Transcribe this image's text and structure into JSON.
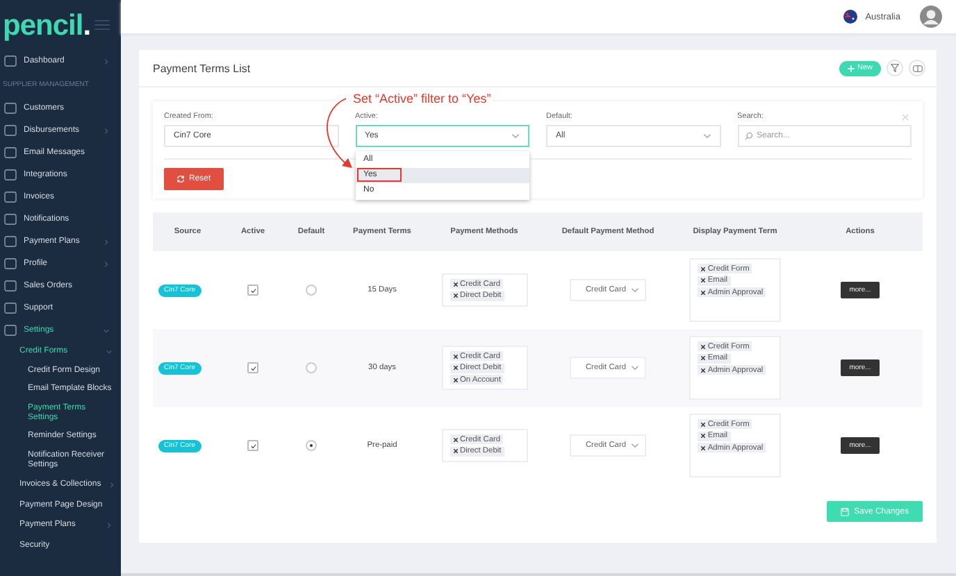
{
  "logo": {
    "text": "pencil",
    "mark": "."
  },
  "header": {
    "country": "Australia"
  },
  "sidebar": {
    "items": [
      {
        "label": "Dashboard",
        "kind": "item",
        "has_submenu": true,
        "selected": false,
        "expanded": false
      },
      {
        "label": "SUPPLIER MANAGEMENT",
        "kind": "section"
      },
      {
        "label": "Customers",
        "kind": "item",
        "has_submenu": false,
        "selected": false
      },
      {
        "label": "Disbursements",
        "kind": "item",
        "has_submenu": true,
        "selected": false,
        "expanded": false
      },
      {
        "label": "Email Messages",
        "kind": "item",
        "has_submenu": false,
        "selected": false
      },
      {
        "label": "Integrations",
        "kind": "item",
        "has_submenu": false,
        "selected": false
      },
      {
        "label": "Invoices",
        "kind": "item",
        "has_submenu": false,
        "selected": false
      },
      {
        "label": "Notifications",
        "kind": "item",
        "has_submenu": false,
        "selected": false
      },
      {
        "label": "Payment Plans",
        "kind": "item",
        "has_submenu": true,
        "selected": false,
        "expanded": false
      },
      {
        "label": "Profile",
        "kind": "item",
        "has_submenu": true,
        "selected": false,
        "expanded": false
      },
      {
        "label": "Sales Orders",
        "kind": "item",
        "has_submenu": false,
        "selected": false
      },
      {
        "label": "Support",
        "kind": "item",
        "has_submenu": false,
        "selected": false
      },
      {
        "label": "Settings",
        "kind": "item",
        "has_submenu": true,
        "selected": true,
        "expanded": true,
        "children": [
          {
            "label": "Credit Forms",
            "has_submenu": true,
            "selected": true,
            "expanded": true,
            "children": [
              {
                "label": "Credit Form Design",
                "selected": false
              },
              {
                "label": "Email Template Blocks",
                "selected": false
              },
              {
                "label": "Payment Terms Settings",
                "selected": true
              },
              {
                "label": "Reminder Settings",
                "selected": false
              },
              {
                "label": "Notification Receiver Settings",
                "selected": false
              }
            ]
          },
          {
            "label": "Invoices & Collections",
            "has_submenu": true,
            "selected": false,
            "expanded": false
          },
          {
            "label": "Payment Page Design",
            "has_submenu": false,
            "selected": false
          },
          {
            "label": "Payment Plans",
            "has_submenu": true,
            "selected": false,
            "expanded": false
          },
          {
            "label": "Security",
            "has_submenu": false,
            "selected": false
          }
        ]
      }
    ]
  },
  "page": {
    "title": "Payment Terms List",
    "new_button": "New"
  },
  "filters": [
    {
      "kind": "text",
      "label": "Created From:",
      "value": "Cin7 Core"
    },
    {
      "kind": "select",
      "label": "Active:",
      "value": "Yes",
      "open": true,
      "options": [
        {
          "label": "All",
          "selected": false,
          "highlighted": false
        },
        {
          "label": "Yes",
          "selected": true,
          "highlighted": true
        },
        {
          "label": "No",
          "selected": false,
          "highlighted": false
        }
      ]
    },
    {
      "kind": "select",
      "label": "Default:",
      "value": "All",
      "open": false
    },
    {
      "kind": "search",
      "label": "Search:",
      "placeholder": "Search..."
    }
  ],
  "reset_button": "Reset",
  "annotation": {
    "text": "Set “Active” filter to “Yes”"
  },
  "table": {
    "columns": [
      "Source",
      "Active",
      "Default",
      "Payment Terms",
      "Payment Methods",
      "Default Payment Method",
      "Display Payment Term",
      "Actions"
    ],
    "rows": [
      {
        "source": "Cin7 Core",
        "active": true,
        "default": false,
        "terms": "15 Days",
        "methods": [
          "Credit Card",
          "Direct Debit"
        ],
        "default_method": "Credit Card",
        "display": [
          "Credit Form",
          "Email",
          "Admin Approval"
        ],
        "action": "more..."
      },
      {
        "source": "Cin7 Core",
        "active": true,
        "default": false,
        "terms": "30 days",
        "methods": [
          "Credit Card",
          "Direct Debit",
          "On Account"
        ],
        "default_method": "Credit Card",
        "display": [
          "Credit Form",
          "Email",
          "Admin Approval"
        ],
        "action": "more..."
      },
      {
        "source": "Cin7 Core",
        "active": true,
        "default": true,
        "terms": "Pre-paid",
        "methods": [
          "Credit Card",
          "Direct Debit"
        ],
        "default_method": "Credit Card",
        "display": [
          "Credit Form",
          "Email",
          "Admin Approval"
        ],
        "action": "more..."
      }
    ]
  },
  "save_button": "Save Changes"
}
